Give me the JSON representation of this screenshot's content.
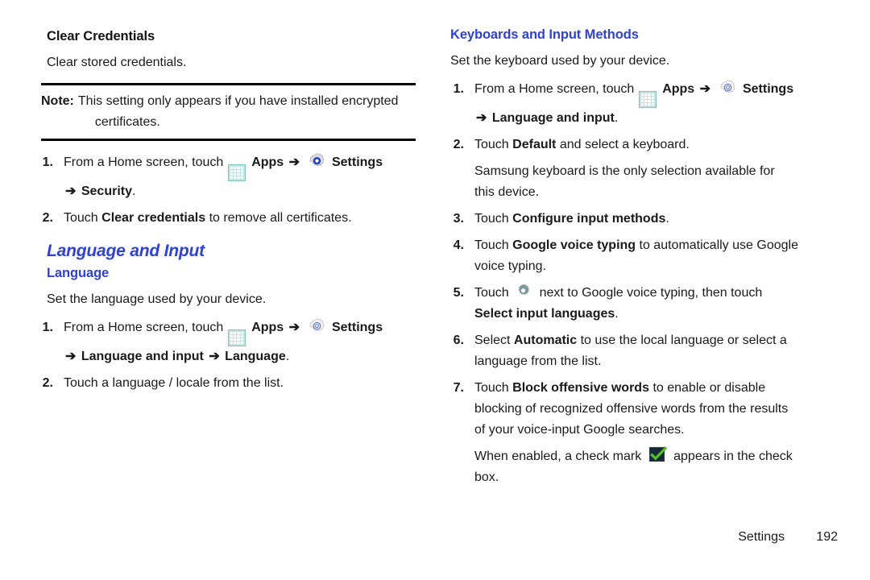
{
  "left_column": {
    "section_heading": "Clear Credentials",
    "intro": "Clear stored credentials.",
    "note": {
      "label": "Note:",
      "text": "This setting only appears if you have installed encrypted",
      "continuation": "certificates."
    },
    "steps": [
      {
        "num": "1.",
        "lead": "From a Home screen, touch",
        "apps_label": "Apps",
        "arrow": "➔",
        "settings_label": "Settings",
        "continuation_arrow": "➔",
        "continuation_bold": "Security",
        "continuation_tail": "."
      },
      {
        "num": "2.",
        "lead": "Touch",
        "bold": "Clear credentials",
        "tail": "to remove all certificates."
      }
    ],
    "language_heading": "Language and Input",
    "language_sub_heading": "Language",
    "language_intro": "Set the language used by your device.",
    "language_steps": [
      {
        "num": "1.",
        "lead": "From a Home screen, touch",
        "apps_label": "Apps",
        "arrow": "➔",
        "settings_label": "Settings",
        "continuation_arrow": "➔",
        "continuation_bold": "Language and input",
        "continuation_arrow2": "➔",
        "continuation_bold2": "Language",
        "continuation_tail": "."
      },
      {
        "num": "2.",
        "lead": "Touch a language / locale from the list."
      }
    ]
  },
  "right_column": {
    "section_heading": "Keyboards and Input Methods",
    "intro": "Set the keyboard used by your device.",
    "steps": [
      {
        "num": "1.",
        "lead": "From a Home screen, touch",
        "apps_label": "Apps",
        "arrow": "➔",
        "settings_label": "Settings",
        "continuation_arrow": "➔",
        "continuation_bold": "Language and input",
        "continuation_tail": "."
      },
      {
        "num": "2.",
        "lead": "Touch",
        "bold": "Default",
        "tail": "and select a keyboard.",
        "sub_paragraph_line1": "Samsung keyboard is the only selection available for",
        "sub_paragraph_line2": "this device."
      },
      {
        "num": "3.",
        "lead": "Touch",
        "bold": "Configure input methods",
        "tail": "."
      },
      {
        "num": "4.",
        "lead": "Touch",
        "bold": "Google voice typing",
        "tail": "to automatically use Google",
        "continuation": "voice typing."
      },
      {
        "num": "5.",
        "lead": "Touch",
        "mid": "next to Google voice typing, then touch",
        "continuation_bold": "Select input languages",
        "continuation_tail": "."
      },
      {
        "num": "6.",
        "lead": "Select",
        "bold": "Automatic",
        "tail": "to use the local language or select a",
        "continuation": "language from the list."
      },
      {
        "num": "7.",
        "lead": "Touch",
        "bold": "Block offensive words",
        "tail": "to enable or disable",
        "continuation": "blocking of recognized offensive words from the results",
        "continuation2": "of your voice-input Google searches."
      }
    ],
    "enabled_note": {
      "lead": "When enabled, a check mark",
      "tail": "appears in the check",
      "continuation": "box."
    }
  },
  "footer": {
    "label": "Settings",
    "page_number": "192"
  },
  "icons": {
    "apps": "apps-grid-icon",
    "settings_gear_filled": "settings-gear-filled-icon",
    "settings_gear_outline": "settings-gear-outline-icon",
    "voice_settings_gear": "voice-settings-gear-icon",
    "checkbox_checked": "checkbox-checked-icon"
  },
  "colors": {
    "heading_blue": "#2b3ff0",
    "apps_icon_teal": "#bfe7e2",
    "gear_blue": "#1b3fd8",
    "gear_teal": "#7d9aa0",
    "check_green": "#54c216",
    "checkbox_navy": "#16283c",
    "text_black": "#1a1a1a"
  }
}
